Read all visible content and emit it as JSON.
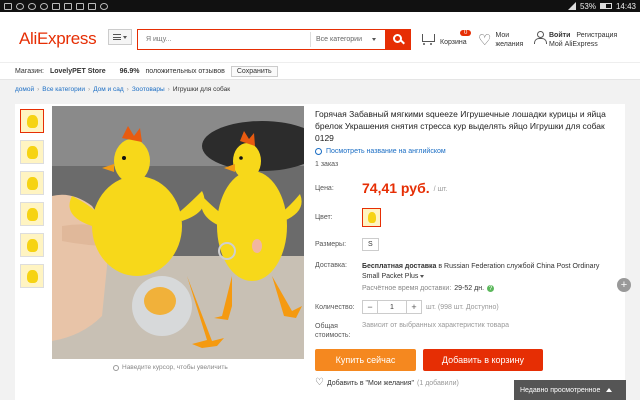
{
  "status_bar": {
    "battery": "53%",
    "time": "14:43"
  },
  "header": {
    "logo": "AliExpress",
    "search_placeholder": "Я ищу...",
    "category_label": "Все категории",
    "cart_label": "Корзина",
    "cart_count": "0",
    "wishlist_line1": "Мои",
    "wishlist_line2": "желания",
    "login_label": "Войти",
    "register_label": "Регистрация",
    "my_aliexpress_label": "Мой AliExpress"
  },
  "store": {
    "prefix": "Магазин:",
    "name": "LovelyPET Store",
    "rating": "96.9%",
    "rating_label": "положительных отзывов",
    "save_label": "Сохранить"
  },
  "breadcrumb": [
    {
      "label": "домой"
    },
    {
      "label": "Все категории"
    },
    {
      "label": "Дом и сад"
    },
    {
      "label": "Зоотовары"
    },
    {
      "label": "Игрушки для собак"
    }
  ],
  "gallery": {
    "zoom_hint": "Наведите курсор, чтобы увеличить"
  },
  "product": {
    "title": "Горячая Забавный мягкими squeeze Игрушечные лошадки курицы и яйца брелок Украшения снятия стресса кур выделять яйцо Игрушки для собак 0129",
    "translate_link": "Посмотреть название на английском",
    "orders": "1 заказ",
    "price_label": "Цена:",
    "price": "74,41 руб.",
    "price_unit": "/ шт.",
    "color_label": "Цвет:",
    "size_label": "Размеры:",
    "size_value": "S",
    "shipping_label": "Доставка:",
    "shipping_free": "Бесплатная доставка",
    "shipping_rest": "в Russian Federation службой China Post Ordinary Small Packet Plus",
    "delivery_estimate_label": "Расчётное время доставки:",
    "delivery_estimate": "29-52 дн.",
    "quantity_label": "Количество:",
    "quantity_value": "1",
    "stock_text": "шт. (998 шт. Доступно)",
    "total_label_1": "Общая",
    "total_label_2": "стоимость:",
    "total_value": "Зависит от выбранных характеристик товара",
    "buy_now": "Купить сейчас",
    "add_to_cart": "Добавить в корзину",
    "add_to_wishlist": "Добавить в \"Мои желания\"",
    "wishlist_count": "(1 добавили)"
  },
  "recently_viewed": "Недавно просмотренное"
}
